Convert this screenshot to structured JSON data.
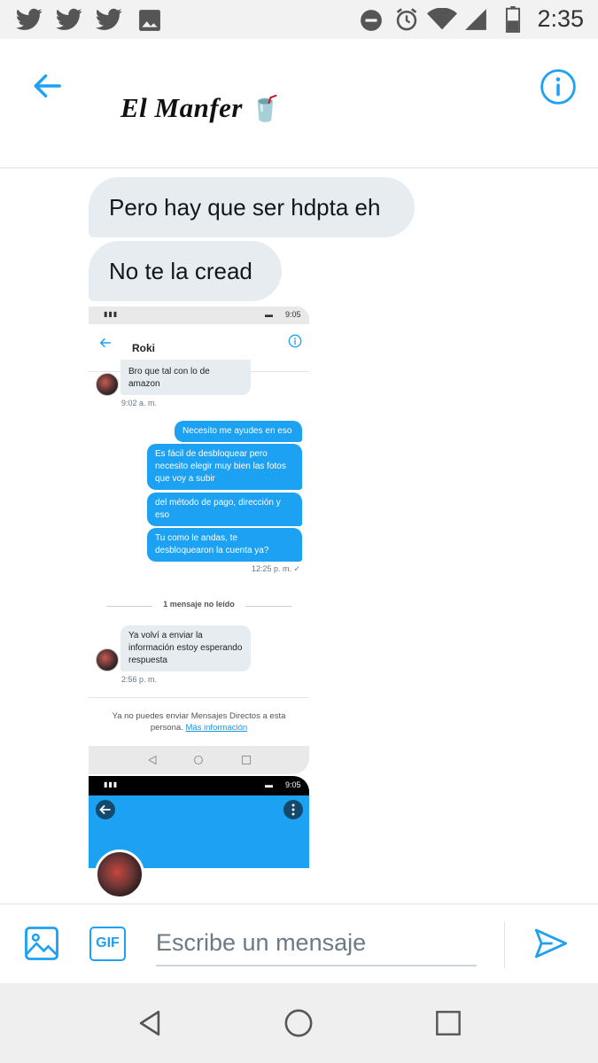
{
  "status_bar": {
    "time": "2:35",
    "left_icons": [
      "twitter-icon",
      "twitter-icon",
      "twitter-icon",
      "image-icon"
    ],
    "right_icons": [
      "do-not-disturb-icon",
      "alarm-icon",
      "wifi-icon",
      "signal-icon",
      "battery-icon"
    ]
  },
  "header": {
    "title": "El Manfer",
    "title_emoji": "🥤",
    "back_icon": "arrow-left-icon",
    "info_icon": "info-icon"
  },
  "messages": [
    {
      "text": "Pero hay que ser hdpta eh",
      "direction": "incoming"
    },
    {
      "text": "No te la cread",
      "direction": "incoming"
    }
  ],
  "attachment": {
    "status_time": "9:05",
    "contact_name": "Roki",
    "incoming_1": "Bro que tal con lo de amazon",
    "incoming_1_time": "9:02 a. m.",
    "outgoing": [
      "Necesito me ayudes en eso",
      "Es fácil de desbloquear pero necesito elegir muy bien las fotos que voy a subir",
      "del método de pago, dirección y eso",
      "Tu como le andas, te desbloquearon la cuenta ya?"
    ],
    "outgoing_time": "12:25 p. m. ✓",
    "unread_divider": "1 mensaje no leído",
    "incoming_2": "Ya volví a enviar la información estoy esperando respuesta",
    "incoming_2_time": "2:56 p. m.",
    "notice_text": "Ya no puedes enviar Mensajes Directos a esta persona.",
    "notice_link": "Más información",
    "status_time_2": "9:05"
  },
  "composer": {
    "placeholder": "Escribe un mensaje",
    "gif_label": "GIF",
    "accent": "#1da1f2"
  },
  "colors": {
    "accent": "#1da1f2",
    "bubble_incoming": "#e7ecf0"
  }
}
